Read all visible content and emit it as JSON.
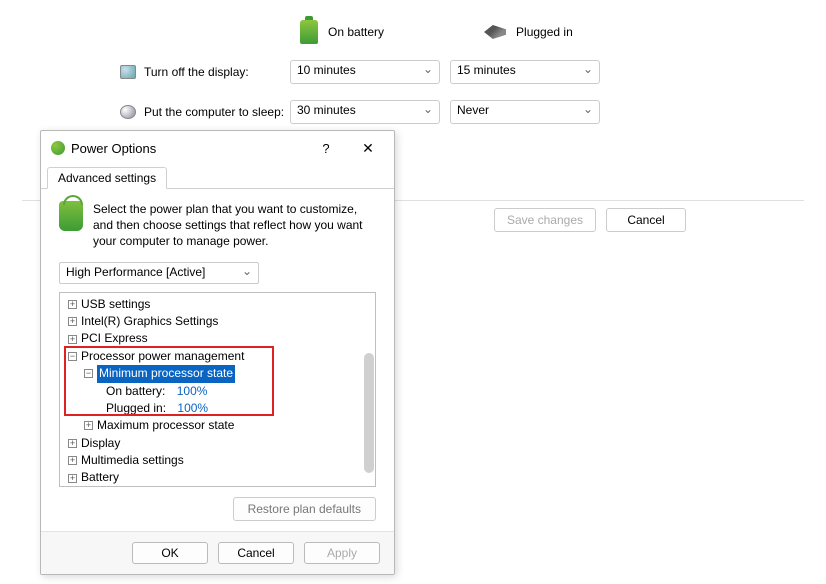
{
  "bg": {
    "col_battery": "On battery",
    "col_plugged": "Plugged in",
    "row_display_label": "Turn off the display:",
    "row_display_battery": "10 minutes",
    "row_display_plugged": "15 minutes",
    "row_sleep_label": "Put the computer to sleep:",
    "row_sleep_battery": "30 minutes",
    "row_sleep_plugged": "Never",
    "save_btn": "Save changes",
    "cancel_btn": "Cancel"
  },
  "dialog": {
    "title": "Power Options",
    "help": "?",
    "close": "✕",
    "tab": "Advanced settings",
    "desc": "Select the power plan that you want to customize, and then choose settings that reflect how you want your computer to manage power.",
    "plan": "High Performance [Active]",
    "tree": {
      "usb": "USB settings",
      "intel": "Intel(R) Graphics Settings",
      "pci": "PCI Express",
      "proc": "Processor power management",
      "min": "Minimum processor state",
      "min_bat_label": "On battery:",
      "min_bat_val": "100%",
      "min_plug_label": "Plugged in:",
      "min_plug_val": "100%",
      "max": "Maximum processor state",
      "display": "Display",
      "multimedia": "Multimedia settings",
      "battery": "Battery"
    },
    "restore": "Restore plan defaults",
    "ok": "OK",
    "cancel": "Cancel",
    "apply": "Apply"
  }
}
